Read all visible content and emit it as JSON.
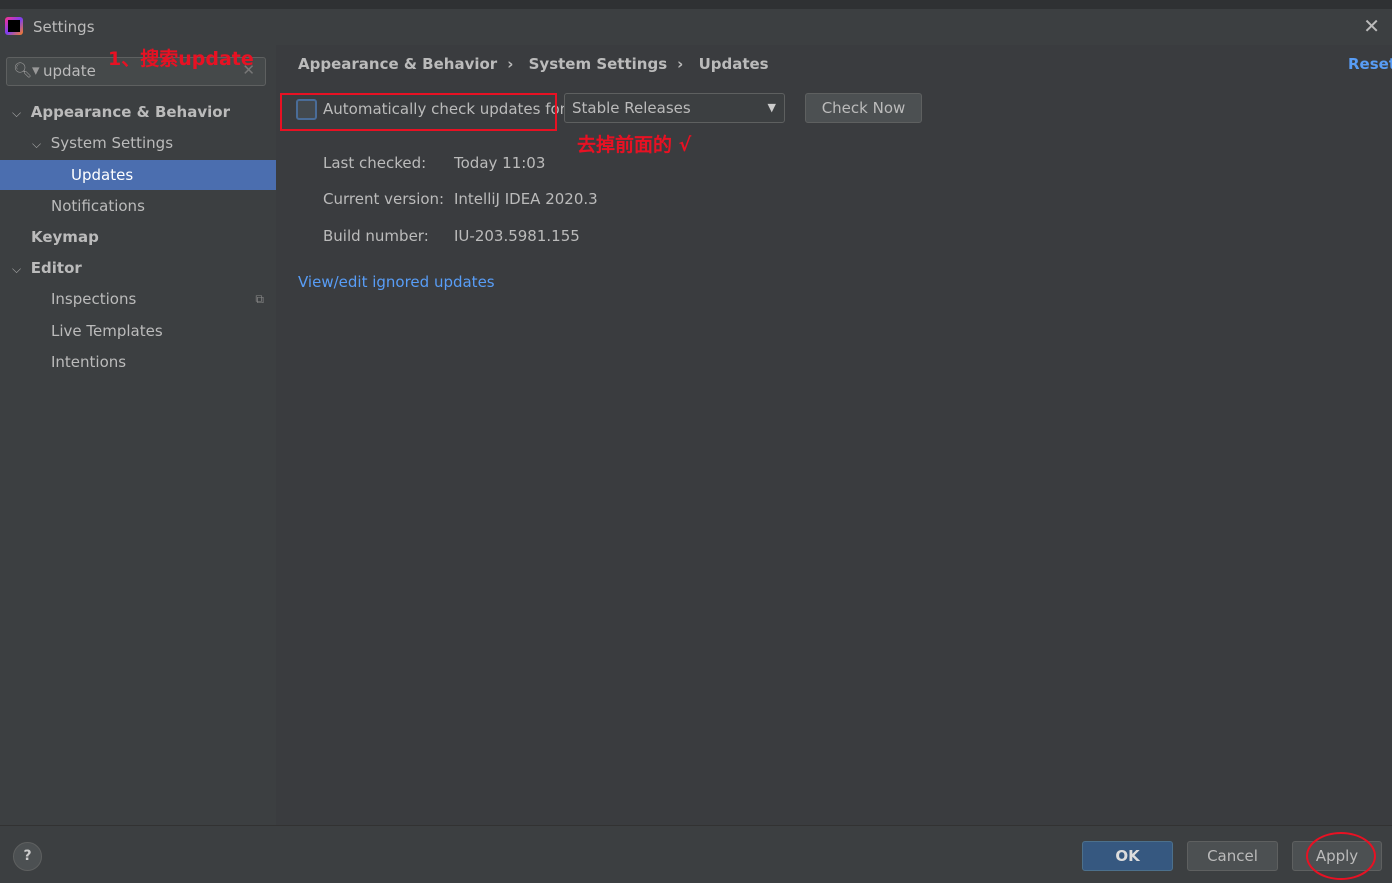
{
  "window": {
    "title": "Settings"
  },
  "search": {
    "value": "update",
    "annotation": "1、搜索update"
  },
  "sidebar": {
    "items": [
      {
        "label": "Appearance & Behavior",
        "level": 0,
        "expanded": true,
        "bold": true
      },
      {
        "label": "System Settings",
        "level": 1,
        "expanded": true
      },
      {
        "label": "Updates",
        "level": 2,
        "selected": true
      },
      {
        "label": "Notifications",
        "level": 1
      },
      {
        "label": "Keymap",
        "level": 0,
        "bold": true
      },
      {
        "label": "Editor",
        "level": 0,
        "expanded": true,
        "bold": true
      },
      {
        "label": "Inspections",
        "level": 1,
        "has_copy_icon": true
      },
      {
        "label": "Live Templates",
        "level": 1
      },
      {
        "label": "Intentions",
        "level": 1
      }
    ]
  },
  "breadcrumb": [
    "Appearance & Behavior",
    "System Settings",
    "Updates"
  ],
  "reset_label": "Reset",
  "updates": {
    "auto_check_label": "Automatically check updates for",
    "auto_check_checked": false,
    "channel": "Stable Releases",
    "check_now": "Check Now",
    "annotation": "去掉前面的 √",
    "last_checked_label": "Last checked:",
    "last_checked": "Today 11:03",
    "current_version_label": "Current version:",
    "current_version": "IntelliJ IDEA 2020.3",
    "build_number_label": "Build number:",
    "build_number": "IU-203.5981.155",
    "ignored_link": "View/edit ignored updates"
  },
  "footer": {
    "help": "?",
    "ok": "OK",
    "cancel": "Cancel",
    "apply": "Apply"
  },
  "colors": {
    "accent": "#4b6eaf",
    "link": "#589df6",
    "annotation": "#e81123"
  }
}
